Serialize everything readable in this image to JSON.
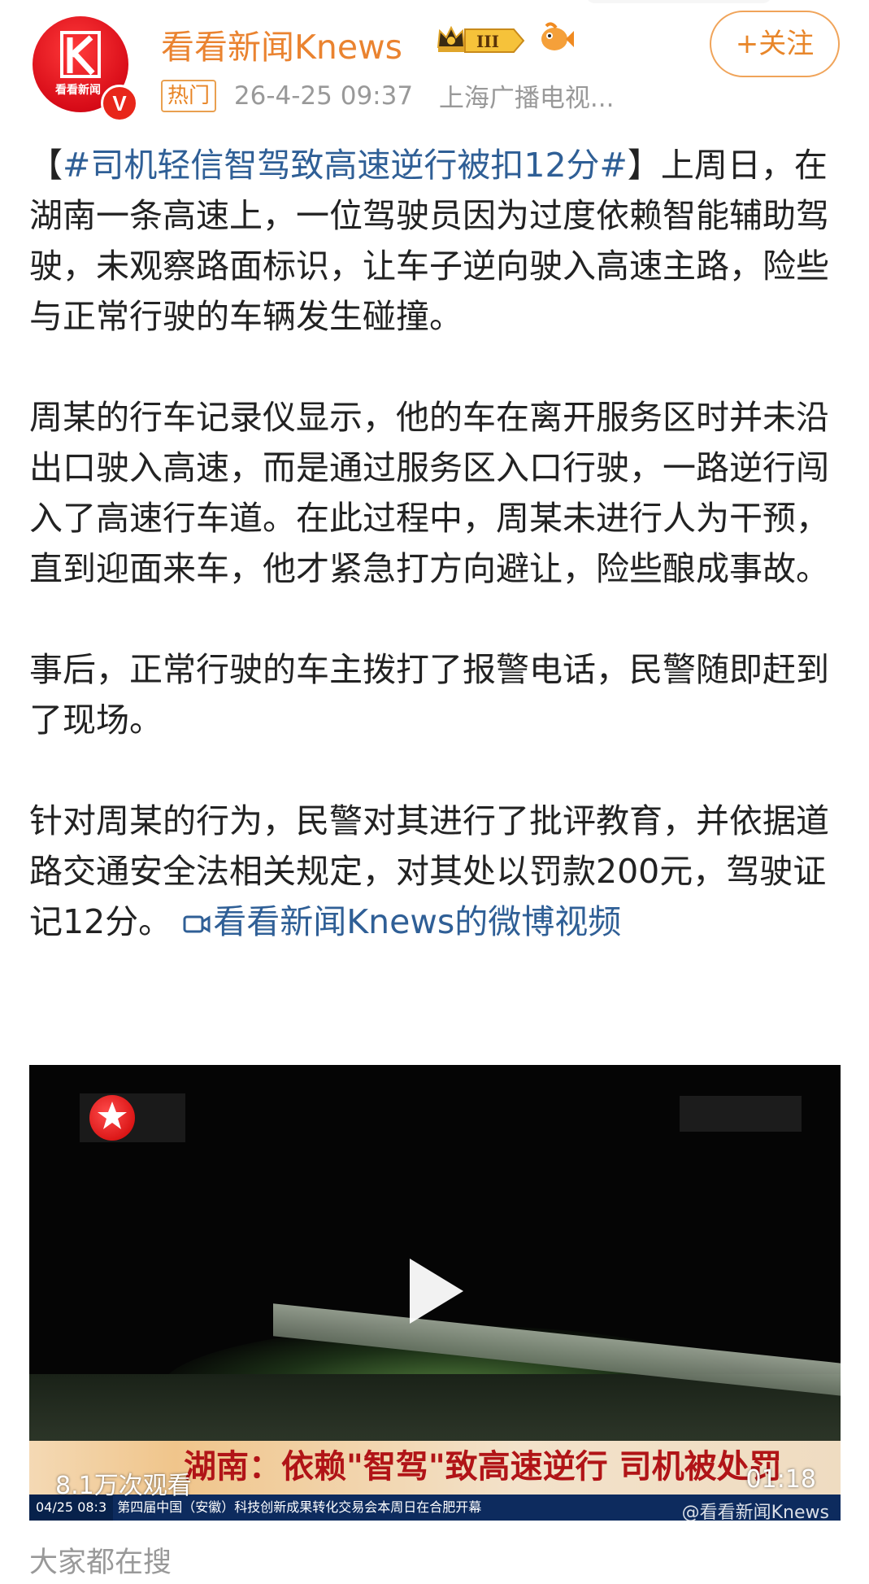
{
  "author": {
    "name": "看看新闻Knews",
    "avatar_text": "看看新闻",
    "verified_badge": "V",
    "level_badge": "III"
  },
  "icons": {
    "crown": "crown-icon",
    "level": "level-badge-icon",
    "fish": "fish-icon",
    "play": "play-icon",
    "video_link": "video-camera-icon"
  },
  "follow_button": {
    "label": "+关注"
  },
  "meta": {
    "hot_badge": "热门",
    "timestamp": "26-4-25 09:37",
    "source": "上海广播电视..."
  },
  "post": {
    "topic": "#司机轻信智驾致高速逆行被扣12分#",
    "p1_rest": "上周日，在湖南一条高速上，一位驾驶员因为过度依赖智能辅助驾驶，未观察路面标识，让车子逆向驶入高速主路，险些与正常行驶的车辆发生碰撞。",
    "p2": "周某的行车记录仪显示，他的车在离开服务区时并未沿出口驶入高速，而是通过服务区入口行驶，一路逆行闯入了高速行车道。在此过程中，周某未进行人为干预，直到迎面来车，他才紧急打方向避让，险些酿成事故。",
    "p3": "事后，正常行驶的车主拨打了报警电话，民警随即赶到了现场。",
    "p4": "针对周某的行为，民警对其进行了批评教育，并依据道路交通安全法相关规定，对其处以罚款200元，驾驶证记12分。",
    "video_link": "看看新闻Knews的微博视频"
  },
  "video": {
    "banner_text": "湖南：依赖\"智驾\"致高速逆行 司机被处罚",
    "ticker_date": "04/25 08:3",
    "ticker_text": "第四届中国（安徽）科技创新成果转化交易会本周日在合肥开幕",
    "views": "8.1万次观看",
    "duration": "01:18",
    "watermark": "@看看新闻Knews"
  },
  "bottom_section": {
    "title": "大家都在搜"
  }
}
